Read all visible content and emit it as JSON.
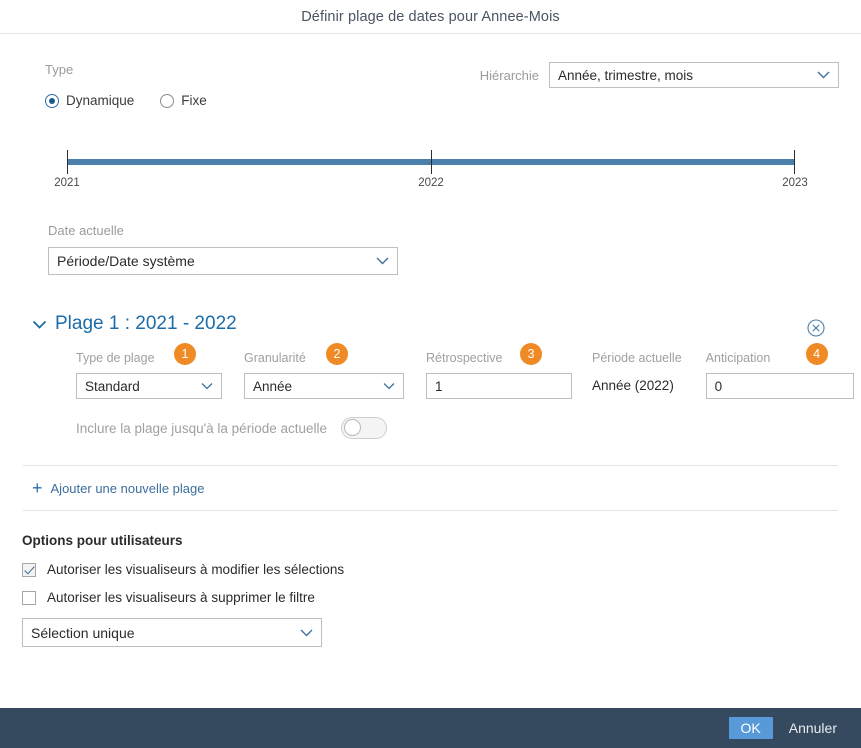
{
  "dialog": {
    "title": "Définir plage de dates pour Annee-Mois"
  },
  "type_section": {
    "label": "Type",
    "options": [
      {
        "label": "Dynamique",
        "selected": true
      },
      {
        "label": "Fixe",
        "selected": false
      }
    ]
  },
  "hierarchy": {
    "label": "Hiérarchie",
    "value": "Année, trimestre, mois"
  },
  "slider": {
    "ticks": [
      "2021",
      "2022",
      "2023"
    ],
    "track_color": "#4a80ab"
  },
  "current_date": {
    "label": "Date actuelle",
    "value": "Période/Date système"
  },
  "range": {
    "title": "Plage 1 : 2021 - 2022",
    "expanded": true,
    "close_title": "Supprimer la plage",
    "fields": [
      {
        "label": "Type de plage",
        "badge": "1",
        "value": "Standard",
        "kind": "select"
      },
      {
        "label": "Granularité",
        "badge": "2",
        "value": "Année",
        "kind": "select"
      },
      {
        "label": "Rétrospective",
        "badge": "3",
        "value": "1",
        "kind": "input"
      },
      {
        "label": "Période actuelle",
        "badge": "",
        "value": "Année (2022)",
        "kind": "static"
      },
      {
        "label": "Anticipation",
        "badge": "4",
        "value": "0",
        "kind": "input"
      }
    ],
    "toggle": {
      "label": "Inclure la plage jusqu'à la période actuelle",
      "on": false
    }
  },
  "add_range": {
    "label": "Ajouter une nouvelle plage",
    "icon": "plus-icon"
  },
  "user_options": {
    "title": "Options pour utilisateurs",
    "checkboxes": [
      {
        "label": "Autoriser les visualiseurs à modifier les sélections",
        "checked": true
      },
      {
        "label": "Autoriser les visualiseurs à supprimer le filtre",
        "checked": false
      }
    ],
    "selection_mode": "Sélection unique"
  },
  "footer": {
    "ok_label": "OK",
    "cancel_label": "Annuler",
    "ok_color": "#5899da",
    "background": "#354a5f"
  },
  "colors": {
    "badge_orange": "#f08a24",
    "link_blue": "#1b6ca8",
    "muted_gray": "#9b9b9b"
  }
}
